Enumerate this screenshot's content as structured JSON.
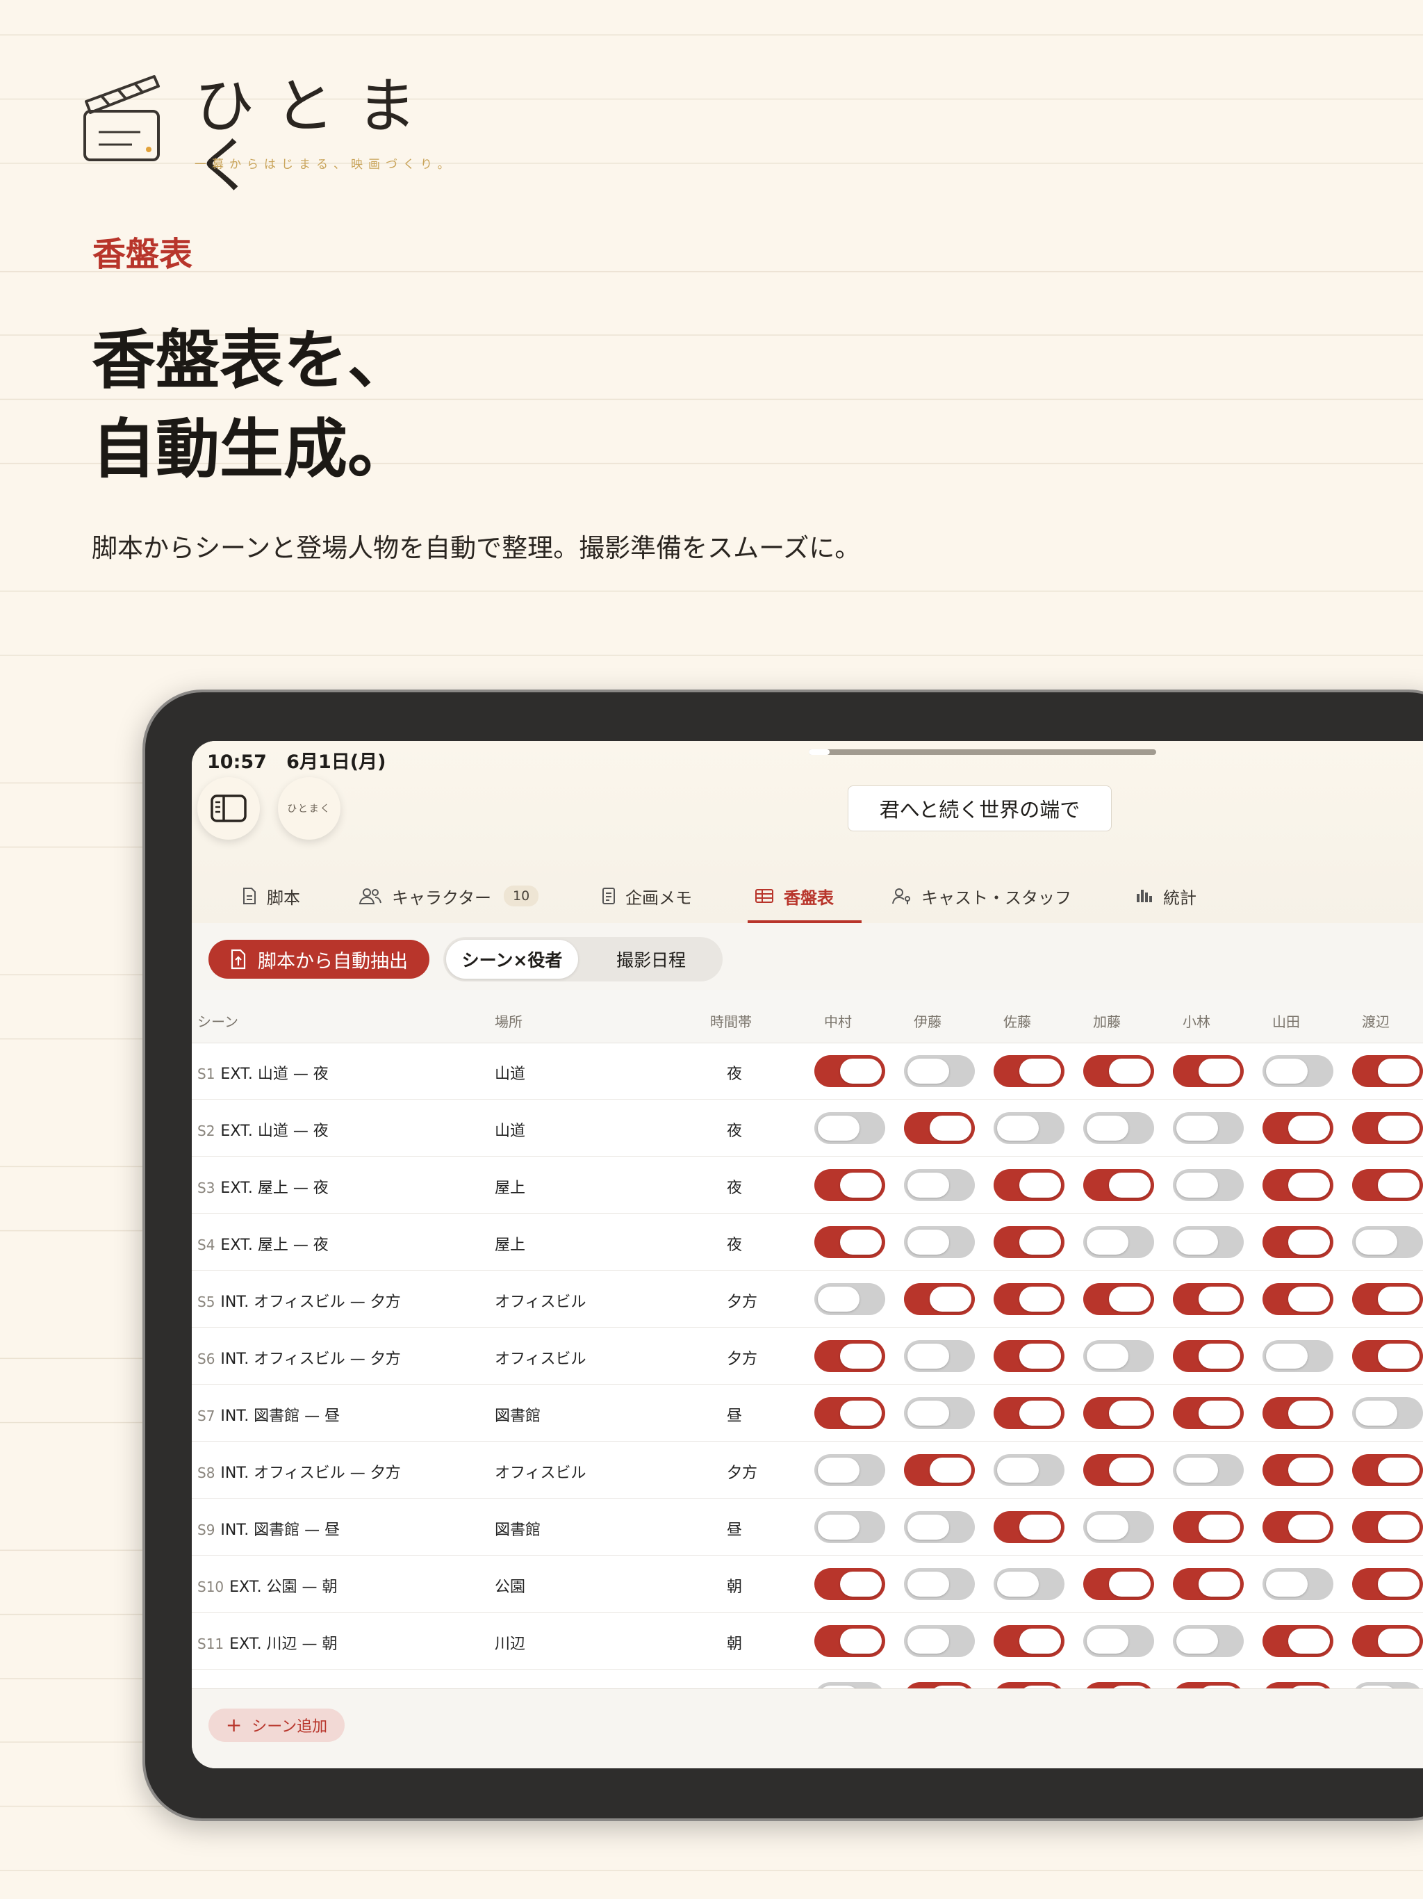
{
  "brand": {
    "name": "ひとまく",
    "tagline": "一幕からはじまる、映画づくり。",
    "accent_color": "#b8352b"
  },
  "promo": {
    "section_label": "香盤表",
    "headline": [
      "香盤表を、",
      "自動生成。"
    ],
    "subcopy": "脚本からシーンと登場人物を自動で整理。撮影準備をスムーズに。"
  },
  "device": {
    "status_time": "10:57",
    "status_date": "6月1日(月)"
  },
  "app": {
    "logo_small": "ひとまく",
    "project_title": "君へと続く世界の端で",
    "tabs": [
      {
        "label": "脚本",
        "icon": "document-icon"
      },
      {
        "label": "キャラクター",
        "icon": "people-icon",
        "badge": "10"
      },
      {
        "label": "企画メモ",
        "icon": "memo-icon"
      },
      {
        "label": "香盤表",
        "icon": "table-icon",
        "active": true
      },
      {
        "label": "キャスト・スタッフ",
        "icon": "person-key-icon"
      },
      {
        "label": "統計",
        "icon": "bar-chart-icon"
      }
    ],
    "toolbar": {
      "extract_label": "脚本から自動抽出",
      "segments": [
        "シーン×役者",
        "撮影日程"
      ]
    },
    "table": {
      "headers": {
        "scene": "シーン",
        "location": "場所",
        "time": "時間帯"
      },
      "actors": [
        "中村",
        "伊藤",
        "佐藤",
        "加藤",
        "小林",
        "山田",
        "渡辺"
      ],
      "rows": [
        {
          "num": "S1",
          "name": "EXT. 山道 — 夜",
          "location": "山道",
          "time": "夜",
          "cast": [
            1,
            0,
            1,
            1,
            1,
            0,
            1
          ]
        },
        {
          "num": "S2",
          "name": "EXT. 山道 — 夜",
          "location": "山道",
          "time": "夜",
          "cast": [
            0,
            1,
            0,
            0,
            0,
            1,
            1
          ]
        },
        {
          "num": "S3",
          "name": "EXT. 屋上 — 夜",
          "location": "屋上",
          "time": "夜",
          "cast": [
            1,
            0,
            1,
            1,
            0,
            1,
            1
          ]
        },
        {
          "num": "S4",
          "name": "EXT. 屋上 — 夜",
          "location": "屋上",
          "time": "夜",
          "cast": [
            1,
            0,
            1,
            0,
            0,
            1,
            0
          ]
        },
        {
          "num": "S5",
          "name": "INT. オフィスビル — 夕方",
          "location": "オフィスビル",
          "time": "夕方",
          "cast": [
            0,
            1,
            1,
            1,
            1,
            1,
            1
          ]
        },
        {
          "num": "S6",
          "name": "INT. オフィスビル — 夕方",
          "location": "オフィスビル",
          "time": "夕方",
          "cast": [
            1,
            0,
            1,
            0,
            1,
            0,
            1
          ]
        },
        {
          "num": "S7",
          "name": "INT. 図書館 — 昼",
          "location": "図書館",
          "time": "昼",
          "cast": [
            1,
            0,
            1,
            1,
            1,
            1,
            0
          ]
        },
        {
          "num": "S8",
          "name": "INT. オフィスビル — 夕方",
          "location": "オフィスビル",
          "time": "夕方",
          "cast": [
            0,
            1,
            0,
            1,
            0,
            1,
            1
          ]
        },
        {
          "num": "S9",
          "name": "INT. 図書館 — 昼",
          "location": "図書館",
          "time": "昼",
          "cast": [
            0,
            0,
            1,
            0,
            1,
            1,
            1
          ]
        },
        {
          "num": "S10",
          "name": "EXT. 公園 — 朝",
          "location": "公園",
          "time": "朝",
          "cast": [
            1,
            0,
            0,
            1,
            1,
            0,
            1
          ]
        },
        {
          "num": "S11",
          "name": "EXT. 川辺 — 朝",
          "location": "川辺",
          "time": "朝",
          "cast": [
            1,
            0,
            1,
            0,
            0,
            1,
            1
          ]
        },
        {
          "num": "",
          "name": "",
          "location": "",
          "time": "",
          "cast": [
            0,
            1,
            1,
            1,
            1,
            1,
            0
          ]
        }
      ]
    },
    "add_scene_label": "シーン追加"
  }
}
